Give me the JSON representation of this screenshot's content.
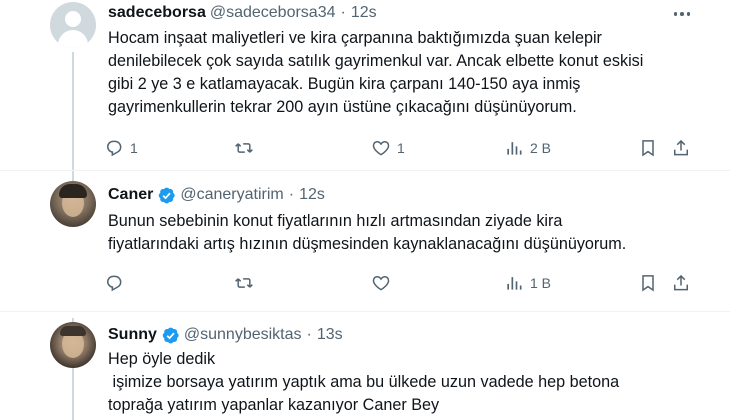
{
  "tweets": [
    {
      "name": "sadeceborsa",
      "handle": "@sadeceborsa34",
      "time": "12s",
      "verified": false,
      "lines": [
        "Hocam inşaat maliyetleri ve kira çarpanına baktığımızda şuan kelepir",
        "denilebilecek çok sayıda satılık gayrimenkul var. Ancak elbette konut eskisi",
        "gibi 2 ye 3 e katlamayacak. Bugün kira çarpanı 140-150 aya inmiş",
        "gayrimenkullerin tekrar 200 ayın üstüne çıkacağını düşünüyorum."
      ],
      "replies": "1",
      "retweets": "",
      "likes": "1",
      "views": "2 B"
    },
    {
      "name": "Caner",
      "handle": "@caneryatirim",
      "time": "12s",
      "verified": true,
      "lines": [
        "Bunun sebebinin konut fiyatlarının hızlı artmasından ziyade kira",
        "fiyatlarındaki artış hızının düşmesinden kaynaklanacağını düşünüyorum."
      ],
      "replies": "",
      "retweets": "",
      "likes": "",
      "views": "1 B"
    },
    {
      "name": "Sunny",
      "handle": "@sunnybesiktas",
      "time": "13s",
      "verified": true,
      "lines": [
        "Hep öyle dedik",
        " işimize borsaya yatırım yaptık ama bu ülkede uzun vadede hep betona",
        "toprağa yatırım yapanlar kazanıyor Caner Bey"
      ]
    }
  ],
  "colors": {
    "text": "#0f1419",
    "secondary": "#536471",
    "verified": "#1d9bf0",
    "thread_line": "#cfd9de",
    "divider": "#eff3f4"
  },
  "icons": [
    "reply-icon",
    "retweet-icon",
    "like-icon",
    "views-icon",
    "bookmark-icon",
    "share-icon",
    "more-icon",
    "verified-icon"
  ]
}
